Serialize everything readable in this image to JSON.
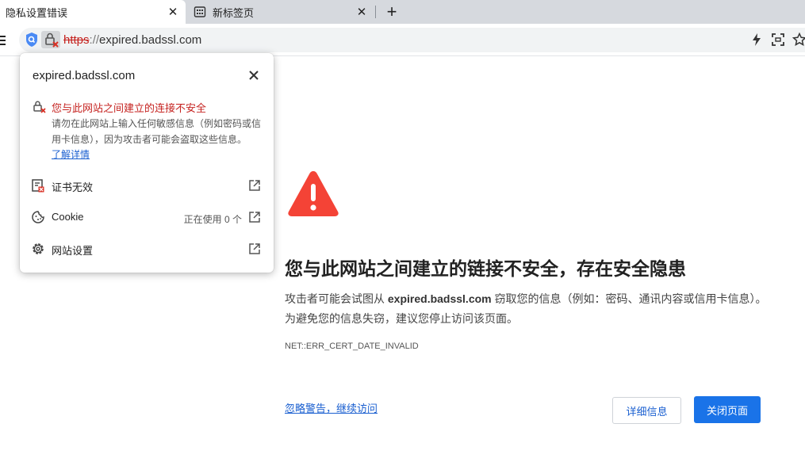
{
  "tabs": [
    {
      "title": "隐私设置错误",
      "active": true
    },
    {
      "title": "新标签页",
      "active": false
    }
  ],
  "address_bar": {
    "scheme": "https",
    "separator": "://",
    "host": "expired.badssl.com"
  },
  "site_info_popup": {
    "domain": "expired.badssl.com",
    "warning_title": "您与此网站之间建立的连接不安全",
    "warning_description": "请勿在此网站上输入任何敏感信息（例如密码或信用卡信息），因为攻击者可能会盗取这些信息。",
    "learn_more": "了解详情",
    "rows": [
      {
        "label": "证书无效",
        "status": ""
      },
      {
        "label": "Cookie",
        "status": "正在使用 0 个"
      },
      {
        "label": "网站设置",
        "status": ""
      }
    ]
  },
  "error_page": {
    "heading": "您与此网站之间建立的链接不安全，存在安全隐患",
    "desc_before": "攻击者可能会试图从 ",
    "desc_host": "expired.badssl.com",
    "desc_after": " 窃取您的信息（例如：密码、通讯内容或信用卡信息）。为避免您的信息失窃，建议您停止访问该页面。",
    "error_code": "NET::ERR_CERT_DATE_INVALID",
    "proceed_link": "忽略警告，继续访问",
    "details_button": "详细信息",
    "close_button": "关闭页面"
  },
  "colors": {
    "danger": "#c5221f",
    "warning_triangle": "#f44336",
    "primary": "#1a73e8",
    "link": "#1a5fd0"
  },
  "icons": [
    "shield-icon",
    "lock-warning-icon",
    "lightning-icon",
    "screenshot-icon",
    "star-icon",
    "close-icon",
    "certificate-icon",
    "cookie-icon",
    "gear-icon",
    "external-link-icon",
    "warning-triangle-icon"
  ]
}
